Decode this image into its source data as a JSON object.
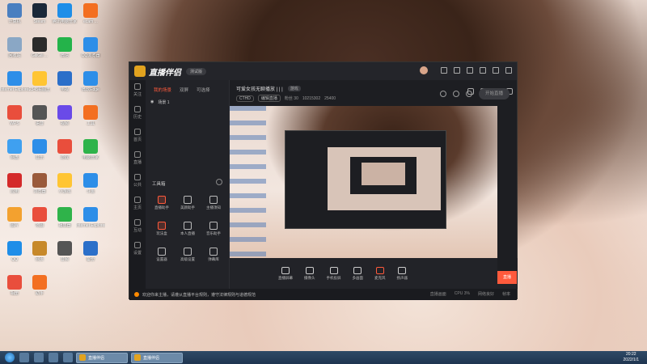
{
  "desktop": {
    "icons": [
      {
        "label": "计算机",
        "color": "#4a7fc0"
      },
      {
        "label": "Steam",
        "color": "#1b2838"
      },
      {
        "label": "腾讯电脑管家",
        "color": "#1f8ee8"
      },
      {
        "label": "ecam ...",
        "color": "#f36f21"
      },
      {
        "label": "回收站",
        "color": "#8aa7c5"
      },
      {
        "label": "GiliGili ...",
        "color": "#2b2b2b"
      },
      {
        "label": "微信",
        "color": "#24b34a"
      },
      {
        "label": "QQ浏览器",
        "color": "#2d8ee8"
      },
      {
        "label": "Internet Explorer",
        "color": "#2d8ee8"
      },
      {
        "label": "2345看图王",
        "color": "#ffc533"
      },
      {
        "label": "电视",
        "color": "#2b6fc9"
      },
      {
        "label": "微软Edge",
        "color": "#2d8ee8"
      },
      {
        "label": "WPS",
        "color": "#e94e3c"
      },
      {
        "label": "语音",
        "color": "#555"
      },
      {
        "label": "视频",
        "color": "#6a4ae8"
      },
      {
        "label": "工具",
        "color": "#f36f21"
      },
      {
        "label": "网盘",
        "color": "#3fa0f0"
      },
      {
        "label": "音乐",
        "color": "#2d8ee8"
      },
      {
        "label": "游戏",
        "color": "#e94e3c"
      },
      {
        "label": "电脑管家",
        "color": "#2fb34a"
      },
      {
        "label": "应用",
        "color": "#d42a2a"
      },
      {
        "label": "浏览器",
        "color": "#9a5a3a"
      },
      {
        "label": "小游戏",
        "color": "#ffc533"
      },
      {
        "label": "斗鱼",
        "color": "#2d8ee8"
      },
      {
        "label": "图片",
        "color": "#f3a12f"
      },
      {
        "label": "地图",
        "color": "#e94e3c"
      },
      {
        "label": "播放器",
        "color": "#2fb34a"
      },
      {
        "label": "Internet Explorer",
        "color": "#2d8ee8"
      },
      {
        "label": "QQ",
        "color": "#1f8ee8"
      },
      {
        "label": "网页",
        "color": "#c7892a"
      },
      {
        "label": "音频",
        "color": "#555"
      },
      {
        "label": "备份",
        "color": "#2b6fc9"
      },
      {
        "label": "相册",
        "color": "#e94e3c"
      },
      {
        "label": "助手",
        "color": "#f36f21"
      }
    ]
  },
  "app": {
    "title": "直播伴侣",
    "version": "测试版",
    "sidebar": [
      "关注",
      "历史",
      "首页",
      "直播",
      "公共",
      "主页",
      "互动",
      "设置"
    ],
    "panel": {
      "tabs": [
        "我的场景",
        "双屏",
        "可选择"
      ],
      "active_tab": 0,
      "scene": "场景 1",
      "tools_title": "工具箱",
      "tools": [
        {
          "label": "直播助手",
          "hot": true
        },
        {
          "label": "美颜助手",
          "hot": false
        },
        {
          "label": "主播须知",
          "hot": false
        },
        {
          "label": "玩法盒",
          "hot": true
        },
        {
          "label": "本人直播",
          "hot": false
        },
        {
          "label": "音乐助手",
          "hot": false
        },
        {
          "label": "设置器",
          "hot": false
        },
        {
          "label": "高级设置",
          "hot": false
        },
        {
          "label": "弹幕库",
          "hot": false
        }
      ]
    },
    "room": {
      "title": "可爱女孩无聊播放 | | |",
      "tag": "游戏",
      "meta_tags": [
        "CTHD",
        "编辑直播"
      ],
      "stats": [
        "粉丝 30",
        "10215302",
        "25400"
      ]
    },
    "bottom_tools": [
      "直播屏幕",
      "摄像头",
      "手机投屏",
      "多画面",
      "麦克风",
      "扬声器"
    ],
    "start_button": "开始直播",
    "status_text": "欢迎你来主播，请遵从直播平台规则，遵守法律规则与道德规范",
    "status_right": [
      "直播画面",
      "CPU 3%",
      "网络良好",
      "帧率"
    ],
    "side_hot_label": "直播"
  },
  "taskbar": {
    "tasks": [
      "直播伴侣",
      "直播伴侣"
    ],
    "clock_time": "20:22",
    "clock_date": "2022/1/1"
  }
}
